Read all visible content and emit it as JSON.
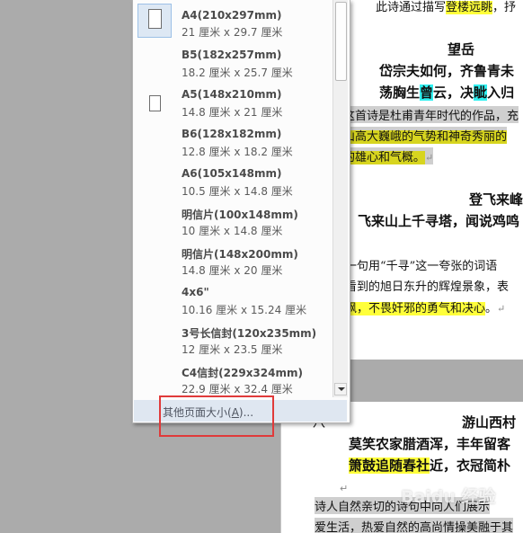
{
  "document": {
    "lines": [
      {
        "text_plain": "此诗通过描写",
        "text_hl": "登楼远眺",
        "text_tail": "，抒"
      },
      {
        "text": "望岳"
      },
      {
        "text": "岱宗夫如何，齐鲁青未"
      },
      {
        "pre": "荡胸生",
        "hl1": "曾",
        "mid": "云，决",
        "hl2": "眦",
        "post": "入归"
      },
      {
        "text": "这首诗是杜甫青年时代的作品，充"
      },
      {
        "pre": "山高大",
        "hl1": "巍峨",
        "mid": "的气势和",
        "hl2": "神奇秀丽",
        "post": "的"
      },
      {
        "text": "的雄心和气概。"
      },
      {
        "text": "登飞来峰"
      },
      {
        "text": "飞来山上千寻塔，闻说鸡鸣"
      },
      {
        "text": "一句用“千寻”这一夸张的词语"
      },
      {
        "text": "看到的旭日东升的辉煌景象，表"
      },
      {
        "pre": "",
        "hl1": "飒，不畏奸邪的勇气和决心",
        "post": "。"
      },
      {
        "text": "游山西村"
      },
      {
        "text": "莫笑农家腊酒浑，丰年留客"
      },
      {
        "pre": "",
        "hl1": "箫鼓追随春",
        "hl2": "社",
        "post": "近，衣冠简朴"
      },
      {
        "text": "诗人自然亲切的诗句中向人们展示"
      },
      {
        "text": "爱生活，热爱自然的高尚情操美融于其"
      }
    ],
    "lone_mark": "八"
  },
  "dropdown": {
    "items": [
      {
        "name": "A4(210x297mm)",
        "dims": "21 厘米 x 29.7 厘米",
        "selected": true
      },
      {
        "name": "B5(182x257mm)",
        "dims": "18.2 厘米 x 25.7 厘米"
      },
      {
        "name": "A5(148x210mm)",
        "dims": "14.8 厘米 x 21 厘米"
      },
      {
        "name": "B6(128x182mm)",
        "dims": "12.8 厘米 x 18.2 厘米"
      },
      {
        "name": "A6(105x148mm)",
        "dims": "10.5 厘米 x 14.8 厘米"
      },
      {
        "name": "明信片(100x148mm)",
        "dims": "10 厘米 x 14.8 厘米"
      },
      {
        "name": "明信片(148x200mm)",
        "dims": "14.8 厘米 x 20 厘米"
      },
      {
        "name": "4x6\"",
        "dims": "10.16 厘米 x 15.24 厘米"
      },
      {
        "name": "3号长信封(120x235mm)",
        "dims": "12 厘米 x 23.5 厘米"
      },
      {
        "name": "C4信封(229x324mm)",
        "dims": "22.9 厘米 x 32.4 厘米"
      }
    ],
    "more_sizes_pre": "其他页面大小(",
    "more_sizes_key": "A",
    "more_sizes_post": ")..."
  },
  "watermark": "Baidu 经验",
  "colors": {
    "highlight_yellow": "#ffff3a",
    "highlight_cyan": "#2ff0f0",
    "selection_gray": "#cfcfcf",
    "annotation_red": "#e03a3a"
  }
}
